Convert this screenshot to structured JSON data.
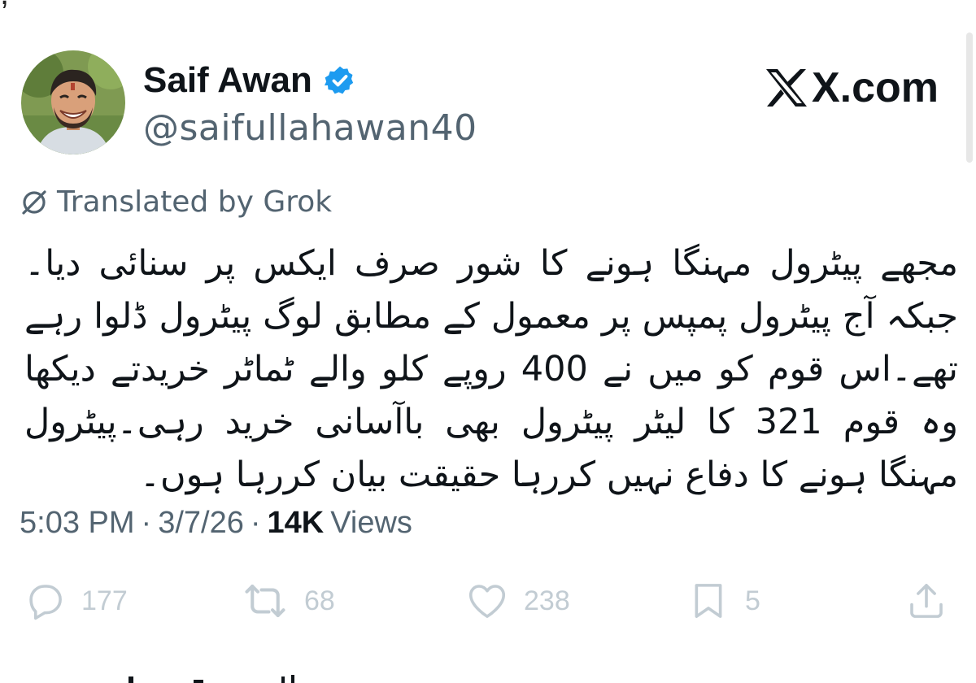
{
  "post": {
    "author": {
      "display_name": "Saif Awan",
      "handle": "@saifullahawan40",
      "verified": true,
      "verified_color": "#1d9bf0"
    },
    "brand": "X.com",
    "translated_label": "Translated by Grok",
    "text": "مجھے پیٹرول مہنگا ہونے کا شور صرف ایکس پر سنائی دیا۔جبکہ آج پیٹرول پمپس پر معمول کے مطابق لوگ پیٹرول ڈلوا رہے تھے۔اس قوم کو میں نے 400 روپے کلو والے ٹماٹر خریدتے دیکھا وہ قوم 321 کا لیٹر پیٹرول بھی باآسانی خرید رہی۔پیٹرول مہنگا ہونے کا دفاع نہیں کررہا حقیقت بیان کررہا ہوں۔",
    "meta": {
      "time": "5:03 PM",
      "date": "3/7/26",
      "views_count": "14K",
      "views_label": "Views",
      "separator": "·"
    },
    "actions": {
      "replies": "177",
      "reposts": "68",
      "likes": "238",
      "bookmarks": "5"
    }
  },
  "icons": {
    "verified": "verified-badge-icon",
    "brand": "x-logo-icon",
    "translate": "grok-icon",
    "reply": "reply-icon",
    "repost": "repost-icon",
    "like": "heart-icon",
    "bookmark": "bookmark-icon",
    "share": "share-icon"
  },
  "colors": {
    "text": "#0f1419",
    "secondary": "#536471",
    "action_icons": "#c2ccd3"
  }
}
